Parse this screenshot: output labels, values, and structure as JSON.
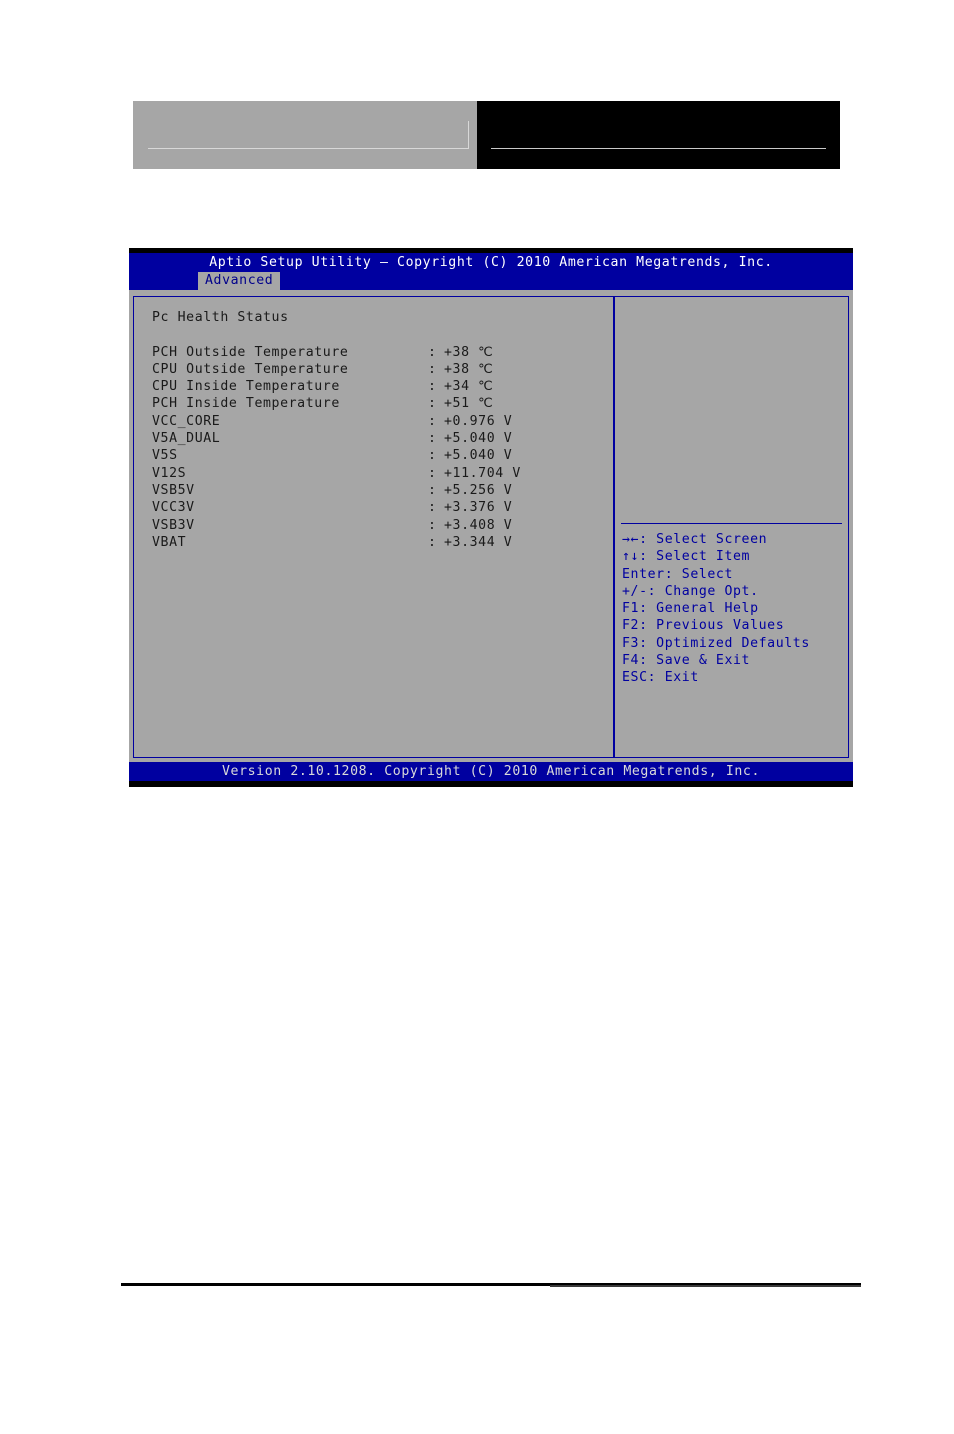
{
  "decor": {
    "left_block": "gray-banner-block",
    "right_block": "black-banner-block"
  },
  "bios": {
    "title": "Aptio Setup Utility – Copyright (C) 2010 American Megatrends, Inc.",
    "active_tab": "Advanced",
    "section_title": "Pc Health Status",
    "readings": [
      {
        "label": "PCH Outside Temperature",
        "separator": ":",
        "value": "+38 ℃"
      },
      {
        "label": "CPU Outside Temperature",
        "separator": ":",
        "value": "+38 ℃"
      },
      {
        "label": "CPU Inside Temperature",
        "separator": ":",
        "value": "+34 ℃"
      },
      {
        "label": "PCH Inside Temperature",
        "separator": ":",
        "value": "+51 ℃"
      },
      {
        "label": "VCC_CORE",
        "separator": ":",
        "value": "+0.976 V"
      },
      {
        "label": "V5A_DUAL",
        "separator": ":",
        "value": "+5.040 V"
      },
      {
        "label": "V5S",
        "separator": ":",
        "value": "+5.040 V"
      },
      {
        "label": "V12S",
        "separator": ":",
        "value": "+11.704 V"
      },
      {
        "label": "VSB5V",
        "separator": ":",
        "value": "+5.256 V"
      },
      {
        "label": "VCC3V",
        "separator": ":",
        "value": "+3.376 V"
      },
      {
        "label": "VSB3V",
        "separator": ":",
        "value": "+3.408 V"
      },
      {
        "label": "VBAT",
        "separator": ":",
        "value": "+3.344 V"
      }
    ],
    "help": [
      "→←: Select Screen",
      "↑↓: Select Item",
      "Enter: Select",
      "+/-: Change Opt.",
      "F1: General Help",
      "F2: Previous Values",
      "F3: Optimized Defaults",
      "F4: Save & Exit",
      "ESC: Exit"
    ],
    "footer": "Version 2.10.1208. Copyright (C) 2010 American Megatrends, Inc."
  },
  "colors": {
    "bios_blue": "#0000a0",
    "bios_gray": "#a6a6a6",
    "title_text": "#ffffff",
    "body_text": "#1a1a1a",
    "help_text": "#0000a0"
  }
}
